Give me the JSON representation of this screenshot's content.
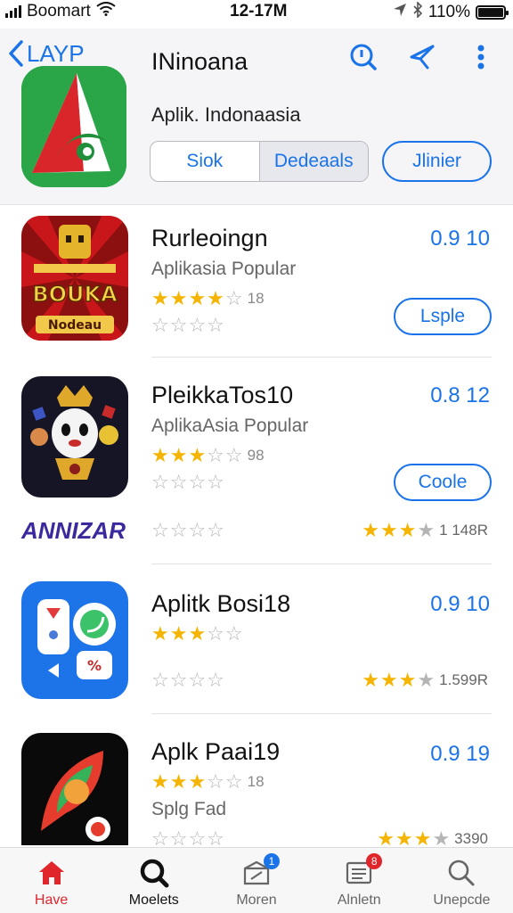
{
  "status_bar": {
    "carrier": "Boomart",
    "time": "12-17M",
    "battery": "110%"
  },
  "header": {
    "back_label": "LAYP",
    "title": "INinoana",
    "subtitle": "Aplik. Indonaasia",
    "segments": [
      "Siok",
      "Dedeaals"
    ],
    "button": "Jlinier",
    "icons": [
      "search-icon",
      "share-icon",
      "more-icon"
    ]
  },
  "apps": [
    {
      "name": "Rurleoingn",
      "subtitle": "Aplikasia Popular",
      "price": "0.9 10",
      "rating_count": "18",
      "button": "Lsple",
      "icon_text": "BOUKA",
      "icon_sub": "Nodeau"
    },
    {
      "name": "PleikkaTos10",
      "subtitle": "AplikaAsia Popular",
      "price": "0.8 12",
      "rating_count": "98",
      "button": "Coole",
      "brand": "ANNIZAR",
      "right_count": "1 148R"
    },
    {
      "name": "Aplitk Bosi18",
      "subtitle": "",
      "price": "0.9 10",
      "right_count": "1.599R"
    },
    {
      "name": "Aplk Paai19",
      "subtitle": "Splg Fad",
      "price": "0.9 19",
      "rating_count": "18",
      "right_count": "3390"
    }
  ],
  "tabs": [
    {
      "label": "Have",
      "icon": "home-icon"
    },
    {
      "label": "Moelets",
      "icon": "search-icon"
    },
    {
      "label": "Moren",
      "icon": "updates-icon",
      "badge": "1"
    },
    {
      "label": "Alnletn",
      "icon": "news-icon",
      "badge": "8"
    },
    {
      "label": "Unepcde",
      "icon": "search-icon"
    }
  ],
  "colors": {
    "accent": "#1a73e8",
    "star": "#f5b400",
    "active_tab": "#e0262b"
  }
}
